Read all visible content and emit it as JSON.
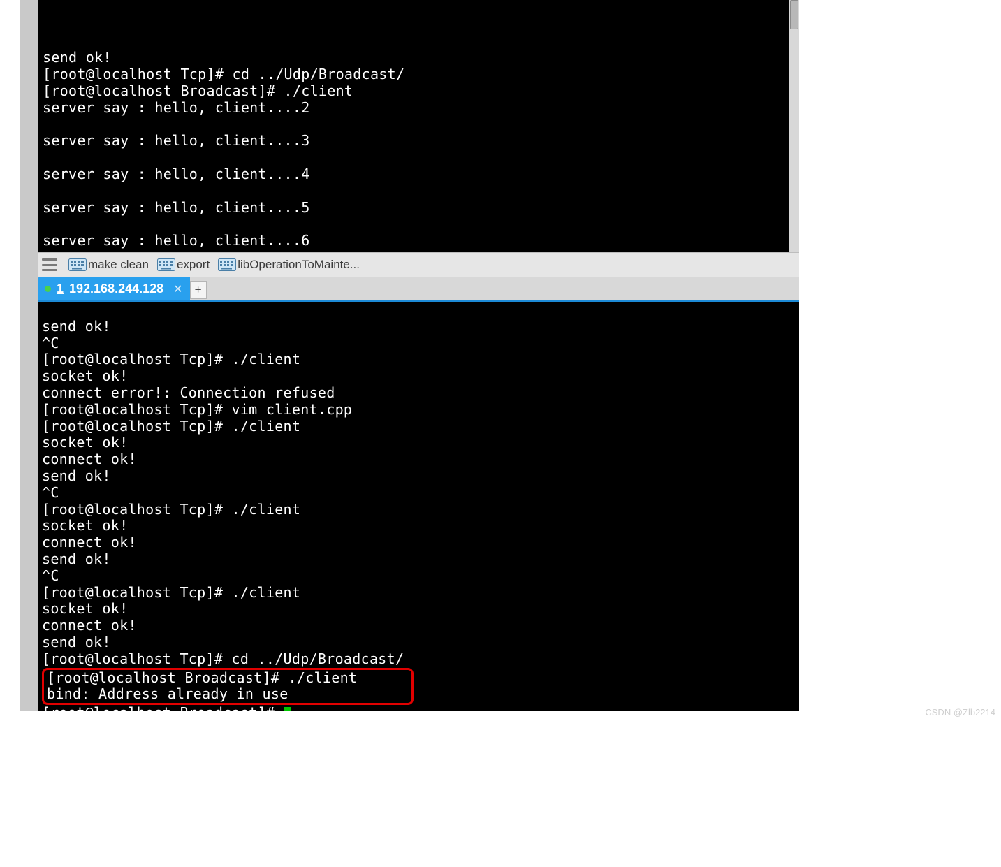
{
  "toolbar": {
    "items": [
      {
        "label": "make clean"
      },
      {
        "label": "export"
      },
      {
        "label": "libOperationToMainte..."
      }
    ]
  },
  "tab": {
    "index": "1",
    "host": "192.168.244.128"
  },
  "term1": {
    "lines": [
      "send ok!",
      "[root@localhost Tcp]# cd ../Udp/Broadcast/",
      "[root@localhost Broadcast]# ./client",
      "server say : hello, client....2",
      "",
      "server say : hello, client....3",
      "",
      "server say : hello, client....4",
      "",
      "server say : hello, client....5",
      "",
      "server say : hello, client....6",
      ""
    ]
  },
  "term2": {
    "lines": [
      "send ok!",
      "^C",
      "[root@localhost Tcp]# ./client",
      "socket ok!",
      "connect error!: Connection refused",
      "[root@localhost Tcp]# vim client.cpp",
      "[root@localhost Tcp]# ./client",
      "socket ok!",
      "connect ok!",
      "send ok!",
      "^C",
      "[root@localhost Tcp]# ./client",
      "socket ok!",
      "connect ok!",
      "send ok!",
      "^C",
      "[root@localhost Tcp]# ./client",
      "socket ok!",
      "connect ok!",
      "send ok!",
      "[root@localhost Tcp]# cd ../Udp/Broadcast/"
    ],
    "boxed": [
      "[root@localhost Broadcast]# ./client",
      "bind: Address already in use"
    ],
    "prompt_after": "[root@localhost Broadcast]# "
  },
  "watermark": "CSDN @Zlb2214"
}
